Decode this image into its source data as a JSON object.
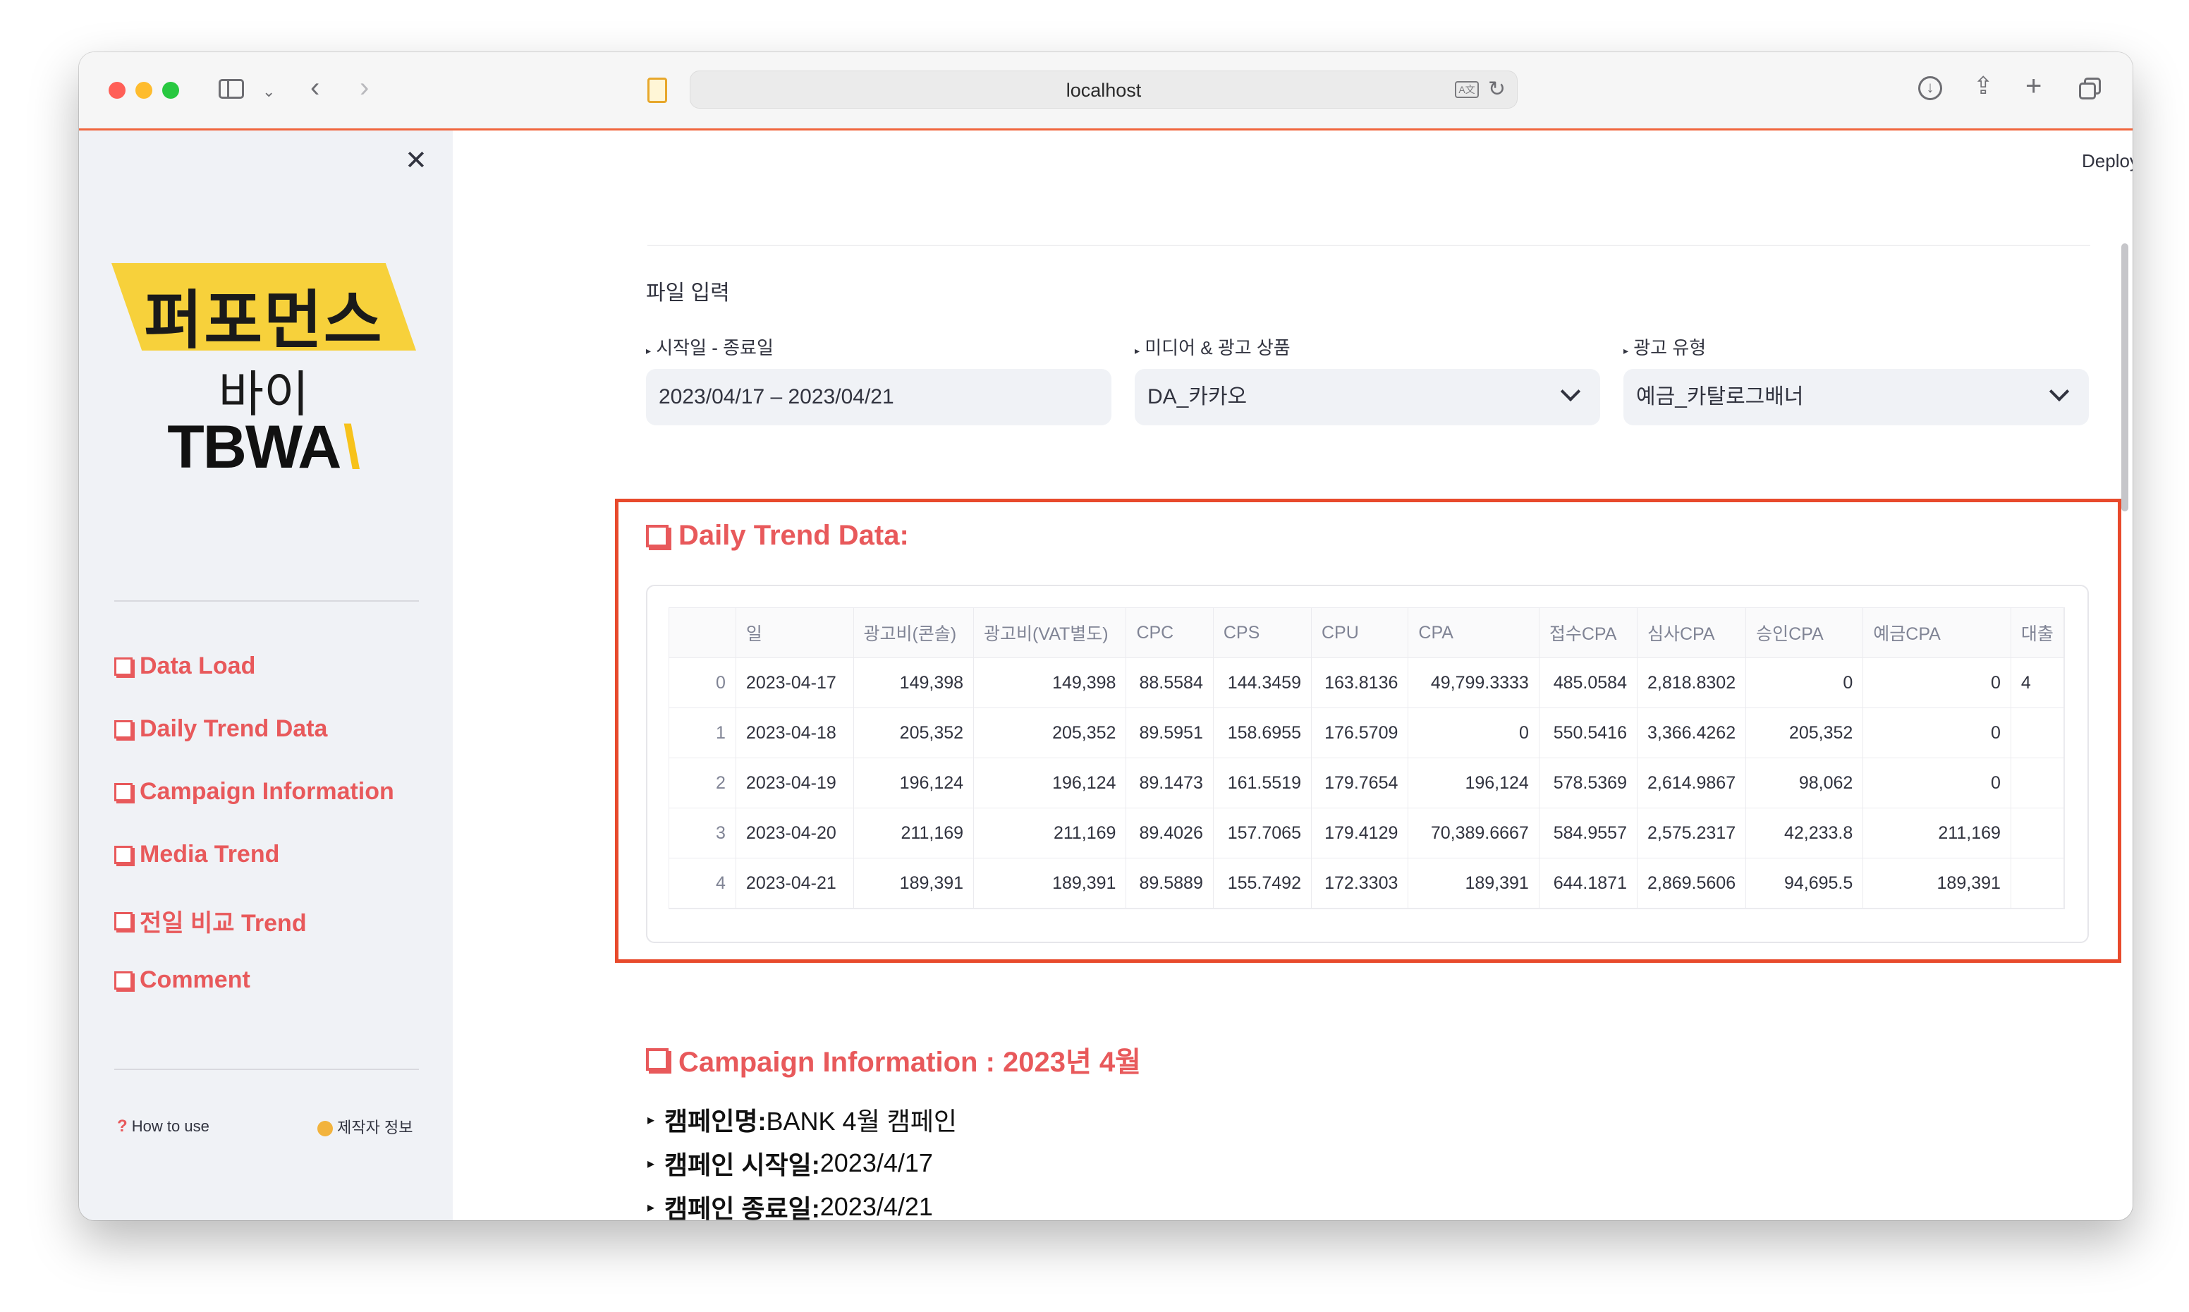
{
  "browser": {
    "url": "localhost"
  },
  "header": {
    "deploy_label": "Deploy"
  },
  "sidebar": {
    "logo": {
      "line1": "퍼포먼스",
      "line2": "바이",
      "line3": "TBWA",
      "accent_color": "#f7d13b"
    },
    "items": [
      {
        "label": "Data Load"
      },
      {
        "label": "Daily Trend Data"
      },
      {
        "label": "Campaign Information"
      },
      {
        "label": "Media Trend"
      },
      {
        "label": "전일 비교 Trend"
      },
      {
        "label": "Comment"
      }
    ],
    "footer": {
      "how_to_use": "How to use",
      "creator": "제작자 정보"
    }
  },
  "file_input": {
    "title": "파일 입력",
    "date_label": "시작일 - 종료일",
    "date_value": "2023/04/17 – 2023/04/21",
    "media_label": "미디어 & 광고 상품",
    "media_value": "DA_카카오",
    "adtype_label": "광고 유형",
    "adtype_value": "예금_카탈로그배너"
  },
  "daily_trend": {
    "title": "Daily Trend Data:",
    "columns": [
      "",
      "일",
      "광고비(콘솔)",
      "광고비(VAT별도)",
      "CPC",
      "CPS",
      "CPU",
      "CPA",
      "접수CPA",
      "심사CPA",
      "승인CPA",
      "예금CPA",
      "대출"
    ],
    "rows": [
      [
        "0",
        "2023-04-17",
        "149,398",
        "149,398",
        "88.5584",
        "144.3459",
        "163.8136",
        "49,799.3333",
        "485.0584",
        "2,818.8302",
        "0",
        "0",
        "4"
      ],
      [
        "1",
        "2023-04-18",
        "205,352",
        "205,352",
        "89.5951",
        "158.6955",
        "176.5709",
        "0",
        "550.5416",
        "3,366.4262",
        "205,352",
        "0",
        ""
      ],
      [
        "2",
        "2023-04-19",
        "196,124",
        "196,124",
        "89.1473",
        "161.5519",
        "179.7654",
        "196,124",
        "578.5369",
        "2,614.9867",
        "98,062",
        "0",
        ""
      ],
      [
        "3",
        "2023-04-20",
        "211,169",
        "211,169",
        "89.4026",
        "157.7065",
        "179.4129",
        "70,389.6667",
        "584.9557",
        "2,575.2317",
        "42,233.8",
        "211,169",
        ""
      ],
      [
        "4",
        "2023-04-21",
        "189,391",
        "189,391",
        "89.5889",
        "155.7492",
        "172.3303",
        "189,391",
        "644.1871",
        "2,869.5606",
        "94,695.5",
        "189,391",
        ""
      ]
    ],
    "highlight_color": "#e84a2c"
  },
  "campaign": {
    "title": "Campaign Information : 2023년 4월",
    "items": [
      {
        "key": "캠페인명:",
        "value": " BANK 4월 캠페인"
      },
      {
        "key": "캠페인 시작일:",
        "value": " 2023/4/17"
      },
      {
        "key": "캠페인 종료일:",
        "value": " 2023/4/21"
      }
    ]
  }
}
